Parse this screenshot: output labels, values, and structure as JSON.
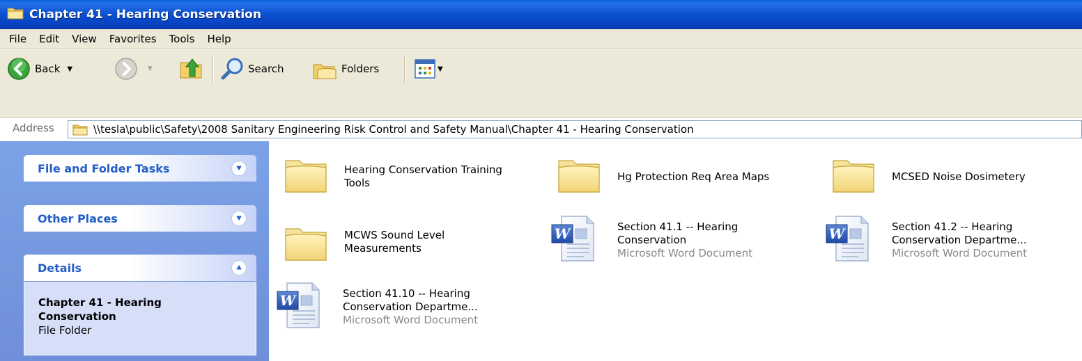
{
  "window": {
    "title": "Chapter 41 - Hearing Conservation"
  },
  "menu": [
    "File",
    "Edit",
    "View",
    "Favorites",
    "Tools",
    "Help"
  ],
  "toolbar": {
    "back": "Back",
    "search": "Search",
    "folders": "Folders"
  },
  "address": {
    "label": "Address",
    "value": "\\\\tesla\\public\\Safety\\2008 Sanitary Engineering Risk Control and Safety Manual\\Chapter 41 - Hearing Conservation"
  },
  "panels": {
    "file_tasks": {
      "title": "File and Folder Tasks",
      "state": "collapsed"
    },
    "other_places": {
      "title": "Other Places",
      "state": "collapsed"
    },
    "details": {
      "title": "Details",
      "state": "expanded",
      "name": "Chapter 41 - Hearing Conservation",
      "type": "File Folder"
    }
  },
  "items": [
    {
      "kind": "folder",
      "name": "Hearing Conservation Training Tools",
      "lines": [
        "Hearing Conservation Training",
        "Tools"
      ]
    },
    {
      "kind": "folder",
      "name": "Hg Protection Req Area Maps",
      "lines": [
        "Hg Protection Req Area Maps"
      ]
    },
    {
      "kind": "folder",
      "name": "MCSED Noise Dosimetery",
      "lines": [
        "MCSED Noise Dosimetery"
      ]
    },
    {
      "kind": "folder",
      "name": "MCWS Sound Level Measurements",
      "lines": [
        "MCWS Sound Level",
        "Measurements"
      ]
    },
    {
      "kind": "word",
      "lines": [
        "Section 41.1 -- Hearing",
        "Conservation"
      ],
      "subtype": "Microsoft Word Document"
    },
    {
      "kind": "word",
      "lines": [
        "Section 41.2 -- Hearing",
        "Conservation Departme..."
      ],
      "subtype": "Microsoft Word Document"
    },
    {
      "kind": "word",
      "lines": [
        "Section 41.10 -- Hearing",
        "Conservation Departme..."
      ],
      "subtype": "Microsoft Word Document"
    }
  ]
}
